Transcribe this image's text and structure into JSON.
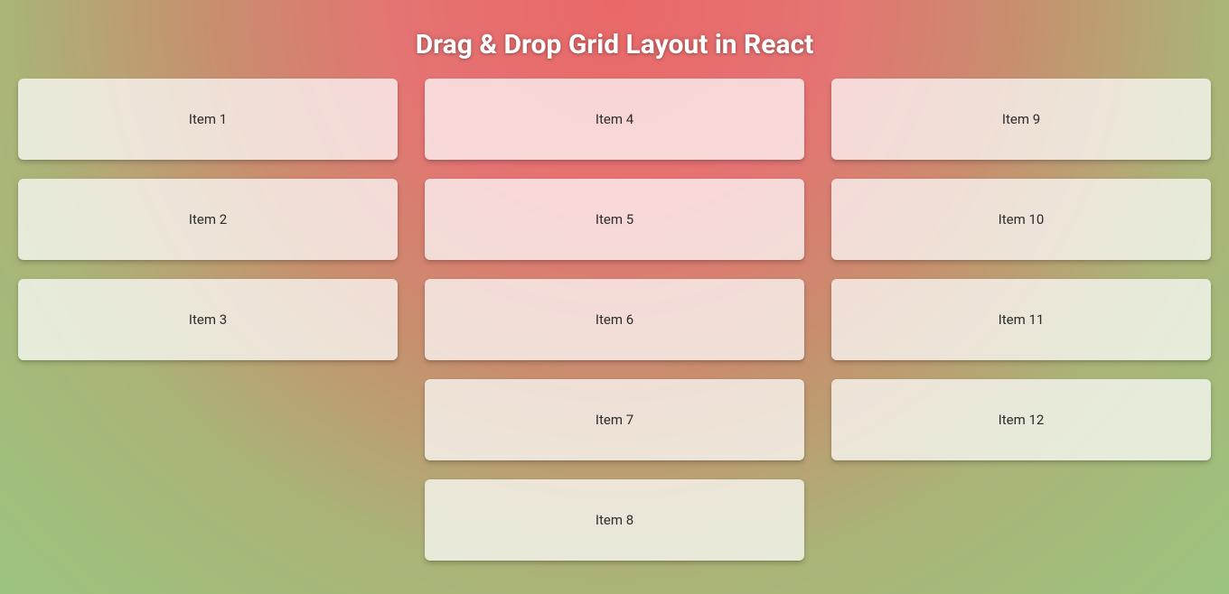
{
  "title": "Drag & Drop Grid Layout in React",
  "columns": [
    {
      "items": [
        {
          "label": "Item 1"
        },
        {
          "label": "Item 2"
        },
        {
          "label": "Item 3"
        }
      ]
    },
    {
      "items": [
        {
          "label": "Item 4"
        },
        {
          "label": "Item 5"
        },
        {
          "label": "Item 6"
        },
        {
          "label": "Item 7"
        },
        {
          "label": "Item 8"
        }
      ]
    },
    {
      "items": [
        {
          "label": "Item 9"
        },
        {
          "label": "Item 10"
        },
        {
          "label": "Item 11"
        },
        {
          "label": "Item 12"
        }
      ]
    }
  ]
}
